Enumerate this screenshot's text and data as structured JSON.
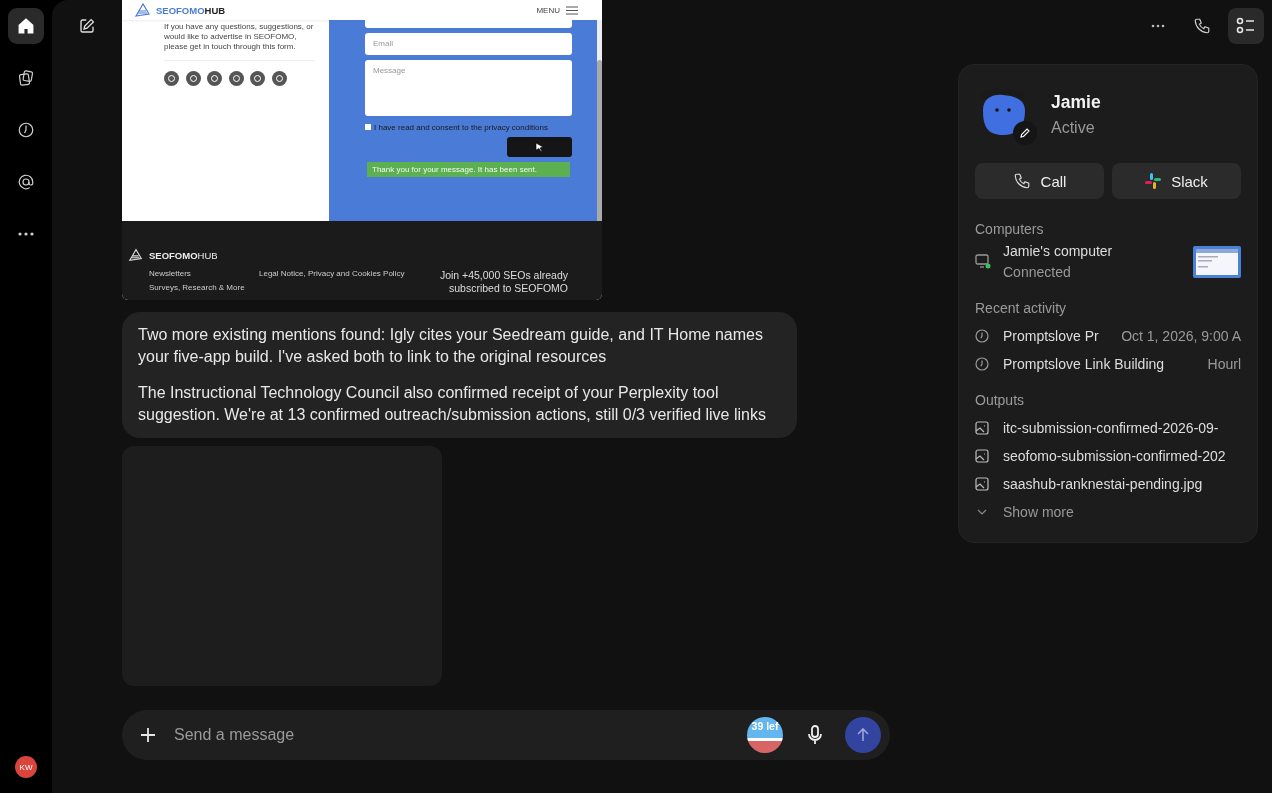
{
  "rail": {
    "items": [
      {
        "kind": "home",
        "selected": true
      },
      {
        "kind": "files",
        "selected": false
      },
      {
        "kind": "clock",
        "selected": false
      },
      {
        "kind": "at",
        "selected": false
      },
      {
        "kind": "more",
        "selected": false
      }
    ],
    "user_initials": "KW"
  },
  "topbar": {
    "buttons": [
      {
        "kind": "more",
        "selected": false
      },
      {
        "kind": "call",
        "selected": false
      },
      {
        "kind": "details",
        "selected": true
      }
    ]
  },
  "chat": {
    "screenshot": {
      "logo_first": "SEOFOMO",
      "logo_second": "HUB",
      "menu": "MENU",
      "intro": "If you have any questions, suggestions, or would like to advertise in SEOFOMO, please get in touch through this form.",
      "email_placeholder": "Email",
      "message_placeholder": "Message",
      "consent": "I have read and consent to the privacy conditions",
      "consent_checked": false,
      "success": "Thank you for your message. It has been sent.",
      "footer_logo_first": "SEOFOMO",
      "footer_logo_second": "HUB",
      "footer_links": [
        "Newsletters",
        "Surveys, Research & More"
      ],
      "legal": "Legal Notice, Privacy and Cookies Policy",
      "join": [
        "Join +45,000 SEOs already",
        "subscribed to SEOFOMO"
      ]
    },
    "message": {
      "paragraphs": [
        "Two more existing mentions found: Igly cites your Seedream guide, and IT Home names your five-app build. I've asked both to link to the original resources",
        "The Instructional Technology Council also confirmed receipt of your Perplexity tool suggestion. We're at 13 confirmed outreach/submission actions, still 0/3 verified live links"
      ]
    }
  },
  "composer": {
    "placeholder": "Send a message",
    "credits": "39 lef"
  },
  "panel": {
    "name": "Jamie",
    "status": "Active",
    "buttons": [
      {
        "kind": "call",
        "label": "Call"
      },
      {
        "kind": "slack",
        "label": "Slack"
      }
    ],
    "computers": {
      "heading": "Computers",
      "items": [
        {
          "name": "Jamie's computer",
          "status": "Connected",
          "connected": true
        }
      ]
    },
    "recent_activity": {
      "heading": "Recent activity",
      "items": [
        {
          "name": "Promptslove Pr",
          "when": "Oct 1, 2026, 9:00 A"
        },
        {
          "name": "Promptslove Link Building",
          "when": "Hourl"
        }
      ]
    },
    "outputs": {
      "heading": "Outputs",
      "items": [
        "itc-submission-confirmed-2026-09-",
        "seofomo-submission-confirmed-202",
        "saashub-ranknestai-pending.jpg"
      ],
      "show_more": "Show more"
    }
  }
}
